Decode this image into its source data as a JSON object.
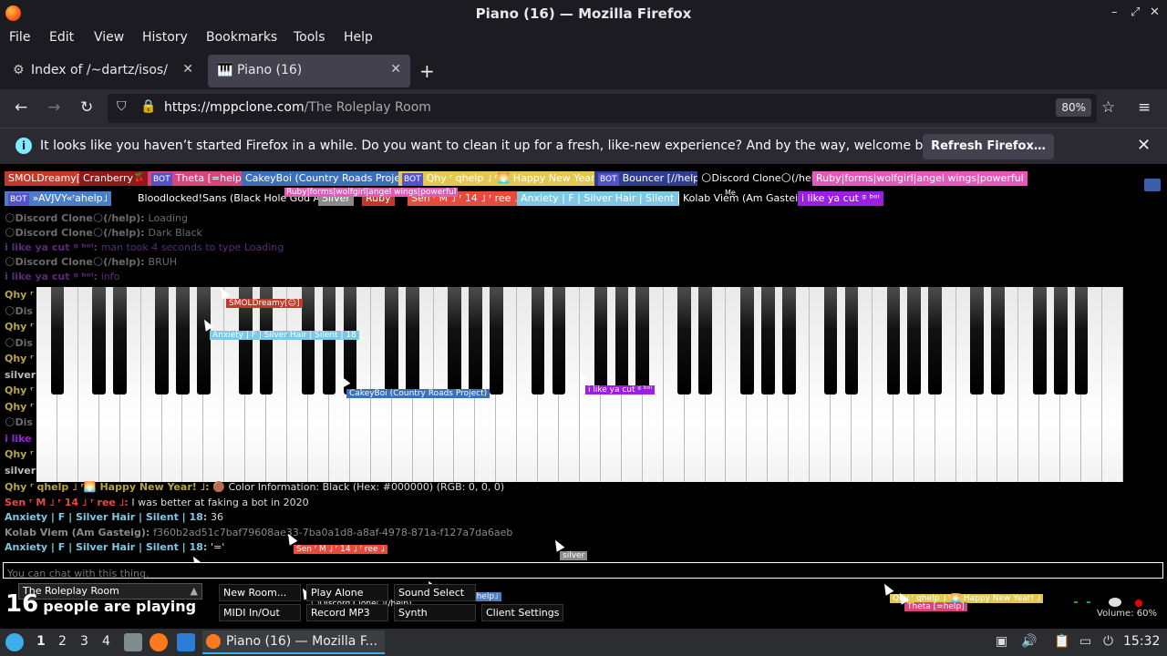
{
  "window": {
    "title": "Piano (16) — Mozilla Firefox",
    "minimize": "–",
    "maximize": "⤢",
    "close": "✕"
  },
  "menu": [
    "File",
    "Edit",
    "View",
    "History",
    "Bookmarks",
    "Tools",
    "Help"
  ],
  "tabs": [
    {
      "label": "Index of /~dartz/isos/",
      "close": "✕"
    },
    {
      "label": "Piano (16)",
      "close": "✕"
    }
  ],
  "newtab": "+",
  "nav": {
    "url_host": "https://mppclone.com",
    "url_path": "/The Roleplay Room",
    "zoom": "80%"
  },
  "notification": {
    "text": "It looks like you haven’t started Firefox in a while. Do you want to clean it up for a fresh, like-new experience? And by the way, welcome back!",
    "button": "Refresh Firefox…",
    "icon": "i",
    "close": "✕"
  },
  "users_row1": [
    {
      "name": "SMOLDreamy[☺]",
      "bg": "#c0392b",
      "color": "#fff"
    },
    {
      "name": "Cranberry🍒",
      "bg": "#8e1b1b",
      "color": "#fff"
    },
    {
      "name": "Theta [=help]",
      "bg": "#d8457a",
      "color": "#fff",
      "bot": true
    },
    {
      "name": "CakeyBoi (Country Roads Project)",
      "bg": "#3d6fb8",
      "color": "#fff"
    },
    {
      "name": "Qhy ʳ qhelp ˩ ʳ🌅 Happy New Year! ˩",
      "bg": "#e3c84f",
      "color": "#fff",
      "bot": true
    },
    {
      "name": "Bouncer [//help]",
      "bg": "#2e3d8f",
      "color": "#fff",
      "bot": true
    },
    {
      "name": "🌕Discord Clone🌕(/help)",
      "bg": "#000",
      "color": "#fff"
    },
    {
      "name": "Ruby|forms|wolfgirl|angel wings|powerful",
      "bg": "#e55ab8",
      "color": "#fff"
    }
  ],
  "users_row2": [
    {
      "name": "»AVJVY«ʳahelp˩",
      "bg": "#4a7ec9",
      "color": "#fff",
      "bot": true
    },
    {
      "name": "Bloodlocked!Sans (Black Hole God AFK)",
      "bg": "#000",
      "color": "#fff"
    },
    {
      "name": "Silver",
      "bg": "#8a8a8a",
      "color": "#fff"
    },
    {
      "name": "Ruby",
      "bg": "#c0392b",
      "color": "#fff"
    },
    {
      "name": "Sen ʳ M ˩ ʳ 14 ˩ ʳ ree ˩",
      "bg": "#e84a3c",
      "color": "#fff"
    },
    {
      "name": "Anxiety | F | Silver Hair | Silent | 18",
      "bg": "#7ec8e3",
      "color": "#fff"
    },
    {
      "name": "Kolab Viem (Am Gasteig)",
      "bg": "#000",
      "color": "#fff"
    },
    {
      "name": "i like ya cut ᵍ ᵇᵒⁱ",
      "bg": "#9b1fe0",
      "color": "#fff"
    }
  ],
  "overlaps": {
    "me_label": "Me",
    "ruby_overlay": "Ruby|forms|wolfgirl|angel wings|powerful"
  },
  "faded_chat": [
    {
      "name": "🌕Discord Clone🌕(/help):",
      "msg": "Loading",
      "color": "#6b6b6b"
    },
    {
      "name": "🌕Discord Clone🌕(/help):",
      "msg": "Dark Black",
      "color": "#6b6b6b"
    },
    {
      "name": "i like ya cut ᵍ ᵇᵒⁱ:",
      "msg": "man took 4 seconds to type Loading",
      "color": "#5a2a7a"
    },
    {
      "name": "🌕Discord Clone🌕(/help):",
      "msg": "BRUH",
      "color": "#6b6b6b"
    },
    {
      "name": "i like ya cut ᵍ ᵇᵒⁱ:",
      "msg": "info",
      "color": "#5a2a7a"
    }
  ],
  "side_names": [
    "Qhy ʳ",
    "🌕Dis",
    "Qhy ʳ",
    "🌕Dis",
    "Qhy ʳ",
    "silver",
    "Qhy ʳ",
    "Qhy ʳ",
    "🌕Dis",
    "i like",
    "Qhy ʳ",
    "silver"
  ],
  "chat": [
    {
      "name": "Qhy ʳ qhelp ˩ ʳ🌅 Happy New Year! ˩:",
      "msg": "🟤 Color Information: Black (Hex: #000000) (RGB: 0, 0, 0)",
      "color": "#b7a541"
    },
    {
      "name": "Sen ʳ M ˩ ʳ 14 ˩ ʳ ree ˩:",
      "msg": "I was better at faking a bot in 2020",
      "color": "#e84a3c"
    },
    {
      "name": "Anxiety | F | Silver Hair | Silent | 18:",
      "msg": "36",
      "color": "#7ec8e3"
    },
    {
      "name": "Kolab Viem (Am Gasteig):",
      "msg": "f360b2ad51c7baf79608ae33-7ba0a1d8-a8af-4978-871a-f127a7da6aeb",
      "color": "#8a8a8a"
    },
    {
      "name": "Anxiety | F | Silver Hair | Silent | 18:",
      "msg": "'='",
      "color": "#7ec8e3"
    }
  ],
  "cursors": [
    {
      "label": "SMOLDreamy[☺]",
      "bg": "#c0392b"
    },
    {
      "label": "Anxiety | F | Silver Hair | Silent | 18",
      "bg": "#7ec8e3"
    },
    {
      "label": "CakeyBoi (Country Roads Project)",
      "bg": "#3d6fb8"
    },
    {
      "label": "i like ya cut ᵍ ᵇᵒⁱ",
      "bg": "#9b1fe0"
    },
    {
      "label": "Sen ʳ M ˩ ʳ 14 ˩ ʳ ree ˩",
      "bg": "#e84a3c"
    },
    {
      "label": "silver",
      "bg": "#8a8a8a"
    },
    {
      "label": "Ruby",
      "bg": "#c0392b"
    },
    {
      "label": "»AVJVY«ʳahelp˩",
      "bg": "#4a7ec9"
    },
    {
      "label": "🌕Discord Clone🌕(/help)",
      "bg": "#000"
    },
    {
      "label": "Qhy ʳ qhelp ˩ ʳ🌅 Happy New Year! ˩",
      "bg": "#e3c84f"
    },
    {
      "label": "Theta [=help]",
      "bg": "#d8457a"
    }
  ],
  "chat_input": {
    "placeholder": "You can chat with this thing."
  },
  "controls": {
    "room": "The Roleplay Room",
    "people_count": "16",
    "people_text": "people are playing",
    "new_room": "New Room...",
    "play_alone": "Play Alone",
    "sound_select": "Sound Select",
    "midi": "MIDI In/Out",
    "record": "Record MP3",
    "synth": "Synth",
    "client_settings": "Client Settings",
    "volume": "Volume: 60%"
  },
  "taskbar": {
    "workspaces": [
      "1",
      "2",
      "3",
      "4"
    ],
    "task": "Piano (16) — Mozilla F...",
    "clock": "15:32"
  }
}
